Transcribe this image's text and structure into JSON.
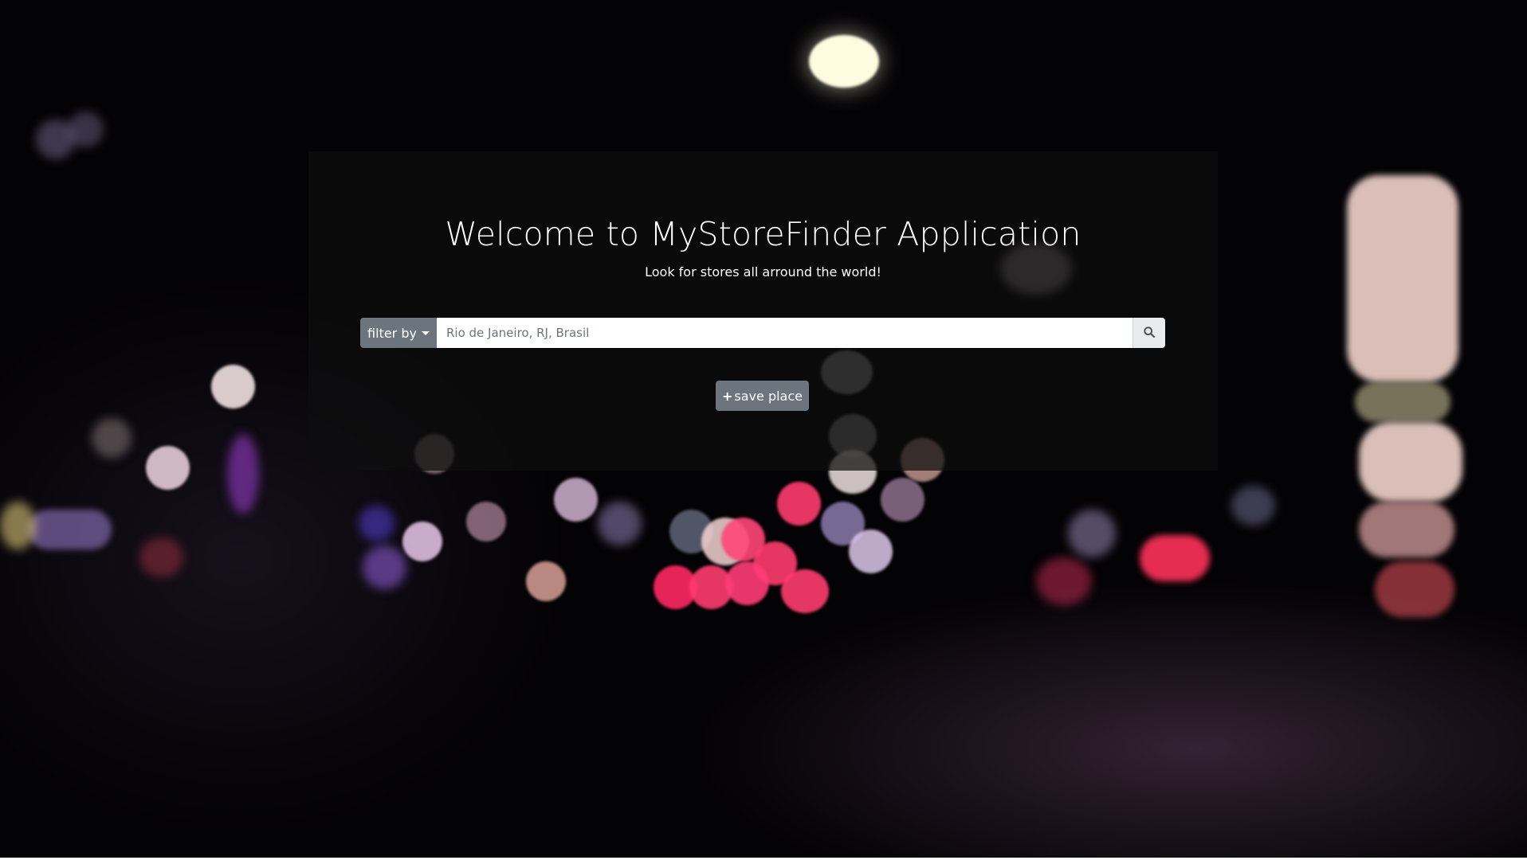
{
  "hero": {
    "title": "Welcome to MyStoreFinder Application",
    "subtitle": "Look for stores all arround the world!"
  },
  "search": {
    "filter_label": "filter by",
    "placeholder": "Rio de Janeiro, RJ, Brasil",
    "value": "",
    "search_icon": "search-icon",
    "caret_icon": "caret-down-icon"
  },
  "actions": {
    "save_label": "save place",
    "save_icon": "plus-icon"
  },
  "colors": {
    "button_secondary": "#6c757d",
    "input_addon": "#e9ecef",
    "overlay": "rgba(14,14,14,0.72)"
  }
}
